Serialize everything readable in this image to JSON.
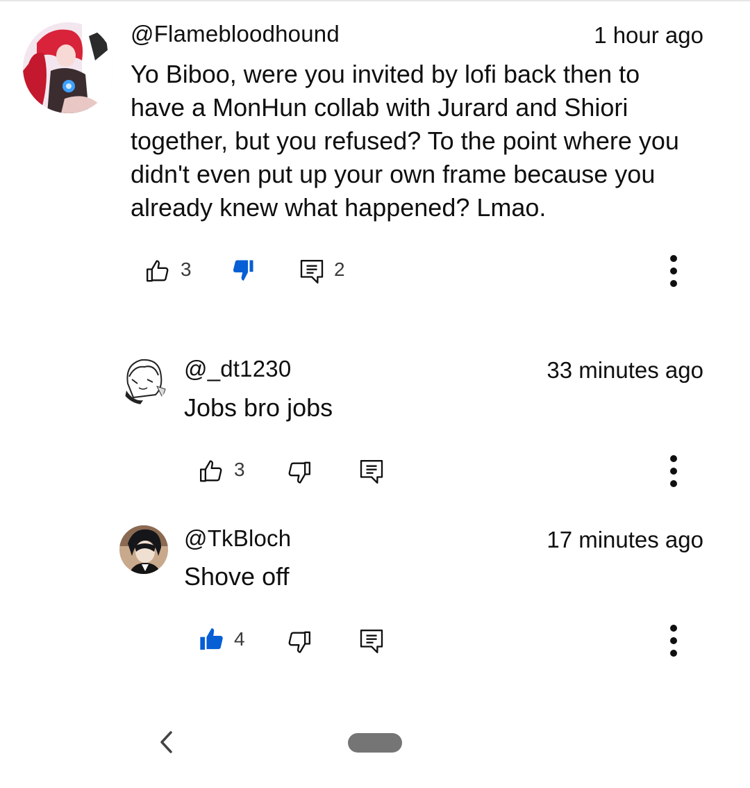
{
  "comment": {
    "handle": "@Flamebloodhound",
    "time": "1 hour ago",
    "text": "Yo Biboo, were you invited by lofi back then to\nhave a MonHun collab with Jurard and Shiori\ntogether, but you refused? To the point where you\ndidn't even put up your own frame because you\nalready knew what happened? Lmao.",
    "likes": "3",
    "replies": "2",
    "liked": false,
    "disliked": true
  },
  "replies": [
    {
      "handle": "@_dt1230",
      "time": "33 minutes ago",
      "text": "Jobs bro jobs",
      "likes": "3",
      "liked": false,
      "disliked": false
    },
    {
      "handle": "@TkBloch",
      "time": "17 minutes ago",
      "text": "Shove off",
      "likes": "4",
      "liked": true,
      "disliked": false
    }
  ],
  "icons": {
    "like": "thumbs-up-icon",
    "dislike": "thumbs-down-icon",
    "reply": "reply-comment-icon",
    "more": "more-vertical-icon",
    "back": "back-chevron-icon",
    "home": "home-pill"
  },
  "colors": {
    "accent": "#065fd4",
    "icon_outline": "#0f0f0f",
    "pill": "#757575"
  }
}
